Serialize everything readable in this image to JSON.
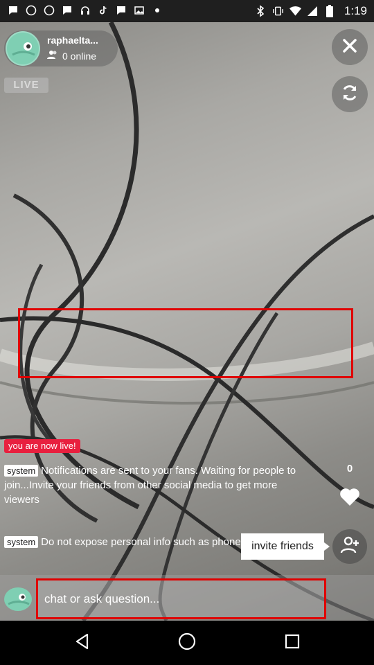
{
  "status_bar": {
    "time": "1:19",
    "icons": [
      "chat-bubble-icon",
      "whatsapp-icon",
      "whatsapp-icon",
      "chat-bubble-icon",
      "headset-icon",
      "tiktok-icon",
      "chat-bubble-icon",
      "photo-icon",
      "dot-icon",
      "bluetooth-icon",
      "vibrate-icon",
      "wifi-icon",
      "signal-icon",
      "battery-icon"
    ]
  },
  "host": {
    "name": "raphaelta...",
    "online_text": "0 online"
  },
  "live_badge": "LIVE",
  "now_live_label": "you are now live!",
  "messages": [
    {
      "tag": "system",
      "text": "Notifications are sent to your fans. Waiting for people to join...Invite your friends from other social media to get more viewers"
    },
    {
      "tag": "system",
      "text": "Do not expose personal info such as phone number"
    }
  ],
  "likes": {
    "count": "0"
  },
  "invite_tooltip": "invite friends",
  "chat": {
    "placeholder": "chat or ask question..."
  },
  "colors": {
    "accent_red": "#e00000",
    "live_red": "#e8203f",
    "avatar_teal": "#7fcfb3"
  }
}
